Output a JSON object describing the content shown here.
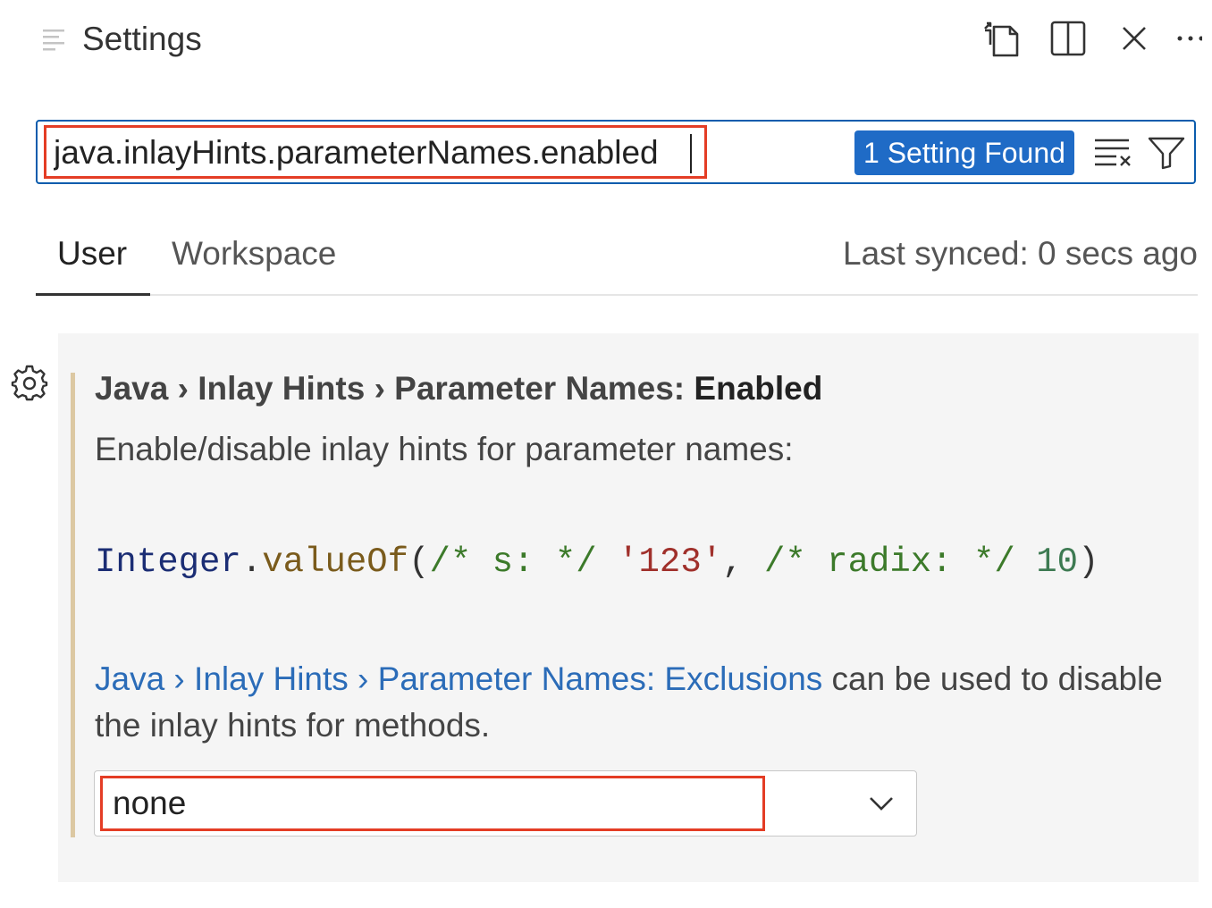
{
  "header": {
    "title": "Settings",
    "icons": {
      "title": "settings-list-icon",
      "open_json": "open-settings-json-icon",
      "split": "split-editor-icon",
      "close": "close-icon",
      "more": "more-actions-icon"
    }
  },
  "search": {
    "value": "java.inlayHints.parameterNames.enabled",
    "result_badge": "1 Setting Found",
    "icons": {
      "clear": "clear-filter-icon",
      "filter": "filter-icon"
    }
  },
  "tabs": {
    "items": [
      {
        "label": "User",
        "active": true
      },
      {
        "label": "Workspace",
        "active": false
      }
    ],
    "sync_status": "Last synced: 0 secs ago"
  },
  "setting": {
    "breadcrumb": "Java › Inlay Hints › Parameter Names: ",
    "name": "Enabled",
    "description": "Enable/disable inlay hints for parameter names:",
    "code_example": {
      "type": "Integer",
      "dot": ".",
      "method": "valueOf",
      "open_paren": "(",
      "comment1": "/* s: */",
      "string_arg": "'123'",
      "comma": ", ",
      "comment2": "/* radix: */",
      "number_arg": "10",
      "close_paren": ")"
    },
    "related_link": "Java › Inlay Hints › Parameter Names: Exclusions",
    "related_text": " can be used to disable the inlay hints for methods.",
    "select": {
      "value": "none"
    },
    "gear_icon": "gear-icon",
    "colors": {
      "modified_bar": "#dcc8a2",
      "highlight_box": "#e43d25",
      "badge": "#1f6bc6"
    }
  }
}
